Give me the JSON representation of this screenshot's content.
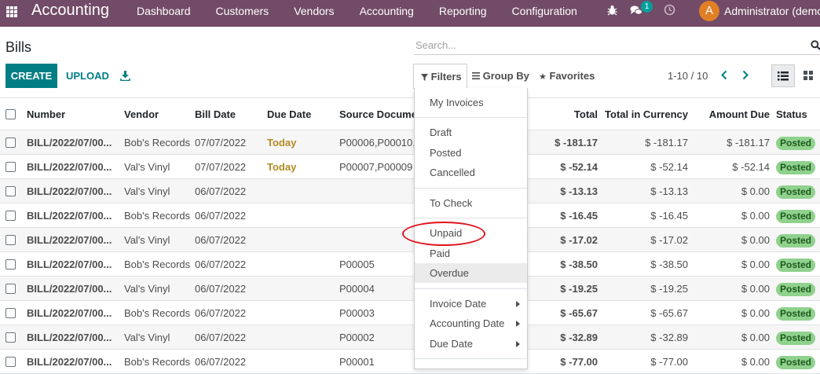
{
  "navbar": {
    "app_name": "Accounting",
    "menu": [
      "Dashboard",
      "Customers",
      "Vendors",
      "Accounting",
      "Reporting",
      "Configuration"
    ],
    "chat_badge": "1",
    "avatar_letter": "A",
    "user": "Administrator (demo)"
  },
  "control_panel": {
    "title": "Bills",
    "search_placeholder": "Search...",
    "create_label": "CREATE",
    "upload_label": "UPLOAD",
    "filters_label": "Filters",
    "groupby_label": "Group By",
    "favorites_label": "Favorites",
    "pager": "1-10 / 10"
  },
  "table": {
    "headers": {
      "number": "Number",
      "vendor": "Vendor",
      "bill_date": "Bill Date",
      "due_date": "Due Date",
      "source": "Source Documen",
      "total": "Total",
      "currency": "Total in Currency",
      "amount_due": "Amount Due",
      "status": "Status"
    },
    "rows": [
      {
        "number": "BILL/2022/07/00...",
        "vendor": "Bob's Records",
        "bill_date": "07/07/2022",
        "due_date": "Today",
        "source": "P00006,P00010,",
        "total": "$ -181.17",
        "currency": "$ -181.17",
        "amount_due": "$ -181.17",
        "status": "Posted"
      },
      {
        "number": "BILL/2022/07/00...",
        "vendor": "Val's Vinyl",
        "bill_date": "07/07/2022",
        "due_date": "Today",
        "source": "P00007,P00009",
        "total": "$ -52.14",
        "currency": "$ -52.14",
        "amount_due": "$ -52.14",
        "status": "Posted"
      },
      {
        "number": "BILL/2022/07/00...",
        "vendor": "Val's Vinyl",
        "bill_date": "06/07/2022",
        "due_date": "",
        "source": "",
        "total": "$ -13.13",
        "currency": "$ -13.13",
        "amount_due": "$ 0.00",
        "status": "Posted"
      },
      {
        "number": "BILL/2022/07/00...",
        "vendor": "Bob's Records",
        "bill_date": "06/07/2022",
        "due_date": "",
        "source": "",
        "total": "$ -16.45",
        "currency": "$ -16.45",
        "amount_due": "$ 0.00",
        "status": "Posted"
      },
      {
        "number": "BILL/2022/07/00...",
        "vendor": "Val's Vinyl",
        "bill_date": "06/07/2022",
        "due_date": "",
        "source": "",
        "total": "$ -17.02",
        "currency": "$ -17.02",
        "amount_due": "$ 0.00",
        "status": "Posted"
      },
      {
        "number": "BILL/2022/07/00...",
        "vendor": "Bob's Records",
        "bill_date": "06/07/2022",
        "due_date": "",
        "source": "P00005",
        "total": "$ -38.50",
        "currency": "$ -38.50",
        "amount_due": "$ 0.00",
        "status": "Posted"
      },
      {
        "number": "BILL/2022/07/00...",
        "vendor": "Val's Vinyl",
        "bill_date": "06/07/2022",
        "due_date": "",
        "source": "P00004",
        "total": "$ -19.25",
        "currency": "$ -19.25",
        "amount_due": "$ 0.00",
        "status": "Posted"
      },
      {
        "number": "BILL/2022/07/00...",
        "vendor": "Bob's Records",
        "bill_date": "06/07/2022",
        "due_date": "",
        "source": "P00003",
        "total": "$ -65.67",
        "currency": "$ -65.67",
        "amount_due": "$ 0.00",
        "status": "Posted"
      },
      {
        "number": "BILL/2022/07/00...",
        "vendor": "Val's Vinyl",
        "bill_date": "06/07/2022",
        "due_date": "",
        "source": "P00002",
        "total": "$ -32.89",
        "currency": "$ -32.89",
        "amount_due": "$ 0.00",
        "status": "Posted"
      },
      {
        "number": "BILL/2022/07/00...",
        "vendor": "Bob's Records",
        "bill_date": "06/07/2022",
        "due_date": "",
        "source": "P00001",
        "total": "$ -77.00",
        "currency": "$ -77.00",
        "amount_due": "$ 0.00",
        "status": "Posted"
      }
    ]
  },
  "filters_dropdown": {
    "my_invoices": "My Invoices",
    "draft": "Draft",
    "posted": "Posted",
    "cancelled": "Cancelled",
    "to_check": "To Check",
    "unpaid": "Unpaid",
    "paid": "Paid",
    "overdue": "Overdue",
    "invoice_date": "Invoice Date",
    "accounting_date": "Accounting Date",
    "due_date": "Due Date"
  },
  "colors": {
    "navbar": "#714b67",
    "primary": "#017e84",
    "today": "#b38b22",
    "posted_badge": "#8fd18d",
    "annotation": "#e0141e"
  },
  "icons": [
    "apps-grid-icon",
    "bug-icon",
    "chat-icon",
    "clock-icon",
    "search-icon",
    "download-icon",
    "filter-icon",
    "list-view-icon",
    "kanban-view-icon",
    "star-icon",
    "chevron-left-icon",
    "chevron-right-icon",
    "caret-right-icon"
  ]
}
